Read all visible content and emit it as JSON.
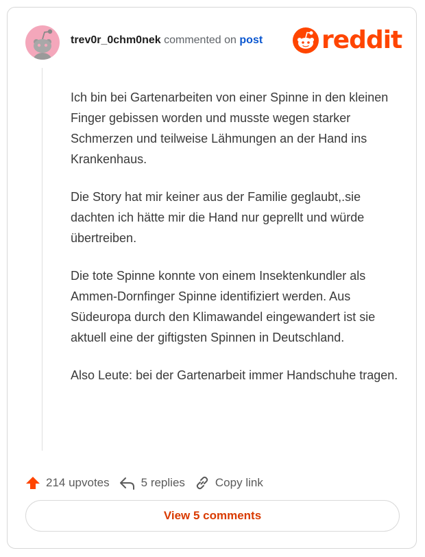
{
  "comment": {
    "username": "trev0r_0chm0nek",
    "commented_on": "commented on",
    "post_link": "post",
    "paragraphs": [
      "Ich bin bei Gartenarbeiten von einer Spinne in den kleinen Finger gebissen worden und musste wegen starker Schmerzen und teilweise Lähmungen an der Hand ins Krankenhaus.",
      "Die Story hat mir keiner aus der Familie geglaubt,.sie dachten ich hätte mir die Hand nur geprellt und würde übertreiben.",
      "Die tote Spinne konnte von einem Insektenkundler als Ammen-Dornfinger Spinne identifiziert werden. Aus Südeuropa durch den Klimawandel eingewandert ist sie aktuell eine der giftigsten Spinnen in Deutschland.",
      "Also Leute: bei der Gartenarbeit immer Handschuhe tragen."
    ]
  },
  "brand": {
    "name": "reddit",
    "color": "#ff4500"
  },
  "actions": {
    "upvotes": "214 upvotes",
    "replies": "5 replies",
    "copy_link": "Copy link"
  },
  "view_button": "View 5 comments",
  "icons": {
    "avatar": "reddit-snoo-avatar",
    "logo": "reddit-snoo-icon",
    "upvote": "upvote-arrow-icon",
    "reply": "reply-arrow-icon",
    "link": "chain-link-icon"
  },
  "colors": {
    "accent": "#ff4500",
    "link": "#0b57d0",
    "button_text": "#d93a00",
    "avatar_bg": "#f4a7bb"
  }
}
